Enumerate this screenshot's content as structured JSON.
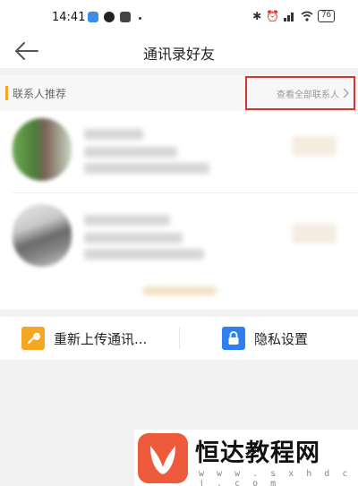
{
  "status_bar": {
    "time": "14:41",
    "battery": "76",
    "left_icons": [
      "app-badge-icon",
      "app-badge-icon",
      "app-badge-icon"
    ],
    "right_icons": [
      "bluetooth-icon",
      "alarm-icon",
      "signal-icon",
      "wifi-icon",
      "battery-icon"
    ]
  },
  "nav": {
    "title": "通讯录好友",
    "back_icon": "back-arrow-icon"
  },
  "recommend": {
    "section_title": "联系人推荐",
    "view_all_label": "查看全部联系人",
    "view_all_icon": "chevron-right-icon",
    "highlight_color": "#d9342b"
  },
  "contacts": [
    {
      "avatar": "blurred-avatar",
      "name": "",
      "detail": ""
    },
    {
      "avatar": "blurred-avatar",
      "name": "",
      "detail": ""
    }
  ],
  "actions": {
    "upload_label": "重新上传通讯...",
    "upload_icon": "wrench-icon",
    "privacy_label": "隐私设置",
    "privacy_icon": "lock-icon"
  },
  "watermark": {
    "brand": "恒达教程网",
    "url": "w w w . s x h d c j . c o m",
    "logo": "leaf-logo"
  },
  "colors": {
    "accent": "#f5a623",
    "privacy_blue": "#2f7ff0",
    "logo_red": "#ee5a3c"
  }
}
